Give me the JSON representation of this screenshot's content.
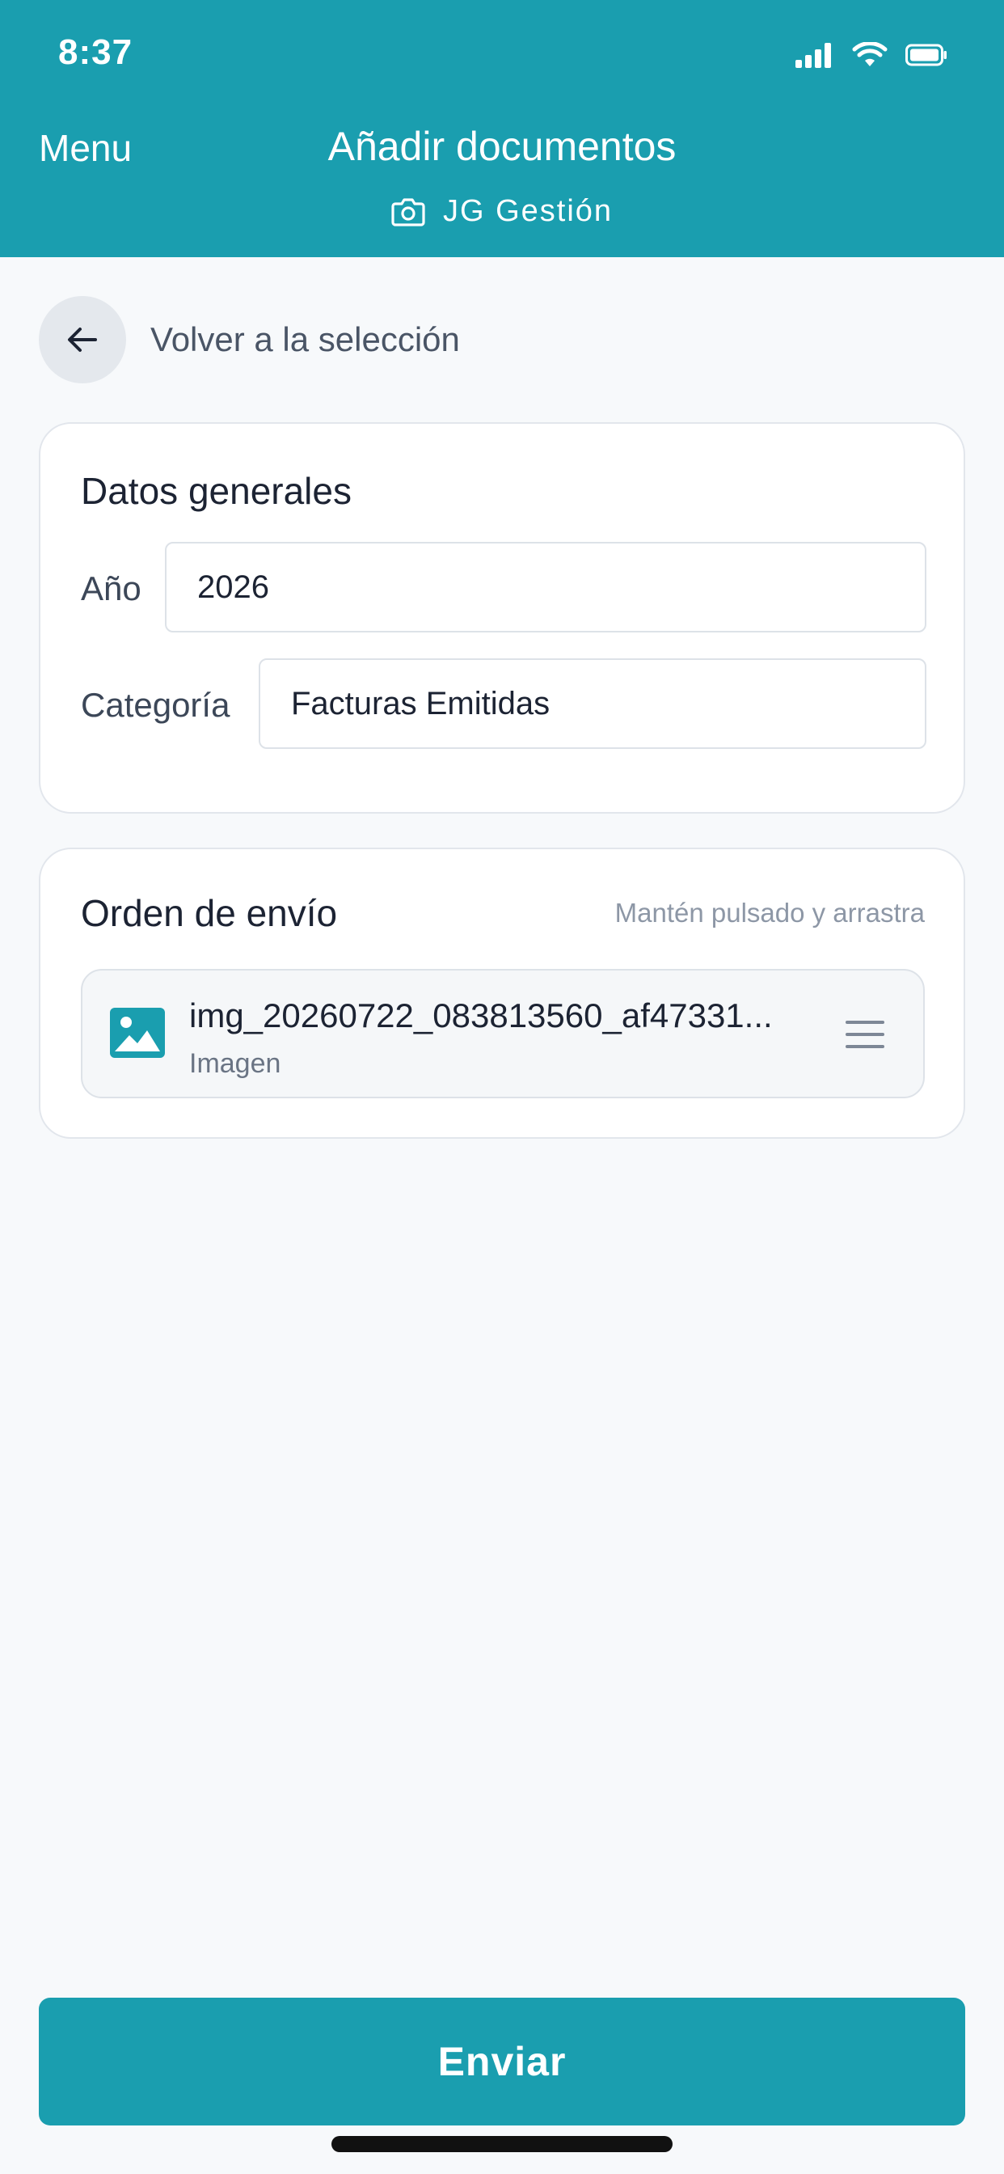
{
  "status_bar": {
    "time": "8:37",
    "signal_icon": "cellular-signal-icon",
    "wifi_icon": "wifi-icon",
    "battery_icon": "battery-icon"
  },
  "header": {
    "menu_label": "Menu",
    "title": "Añadir documentos",
    "subtitle": "JG Gestión",
    "subtitle_icon": "camera-icon",
    "background_color": "#1a9eaf"
  },
  "back": {
    "label": "Volver a la selección",
    "icon": "arrow-left-icon"
  },
  "general": {
    "title": "Datos generales",
    "year_label": "Año",
    "year_value": "2026",
    "category_label": "Categoría",
    "category_value": "Facturas Emitidas"
  },
  "order": {
    "title": "Orden de envío",
    "hint": "Mantén pulsado y arrastra",
    "items": [
      {
        "name": "img_20260722_083813560_af47331...",
        "type": "Imagen",
        "icon": "image-icon",
        "handle_icon": "drag-handle-icon"
      }
    ]
  },
  "actions": {
    "send_label": "Enviar",
    "accent_color": "#1a9eaf"
  }
}
